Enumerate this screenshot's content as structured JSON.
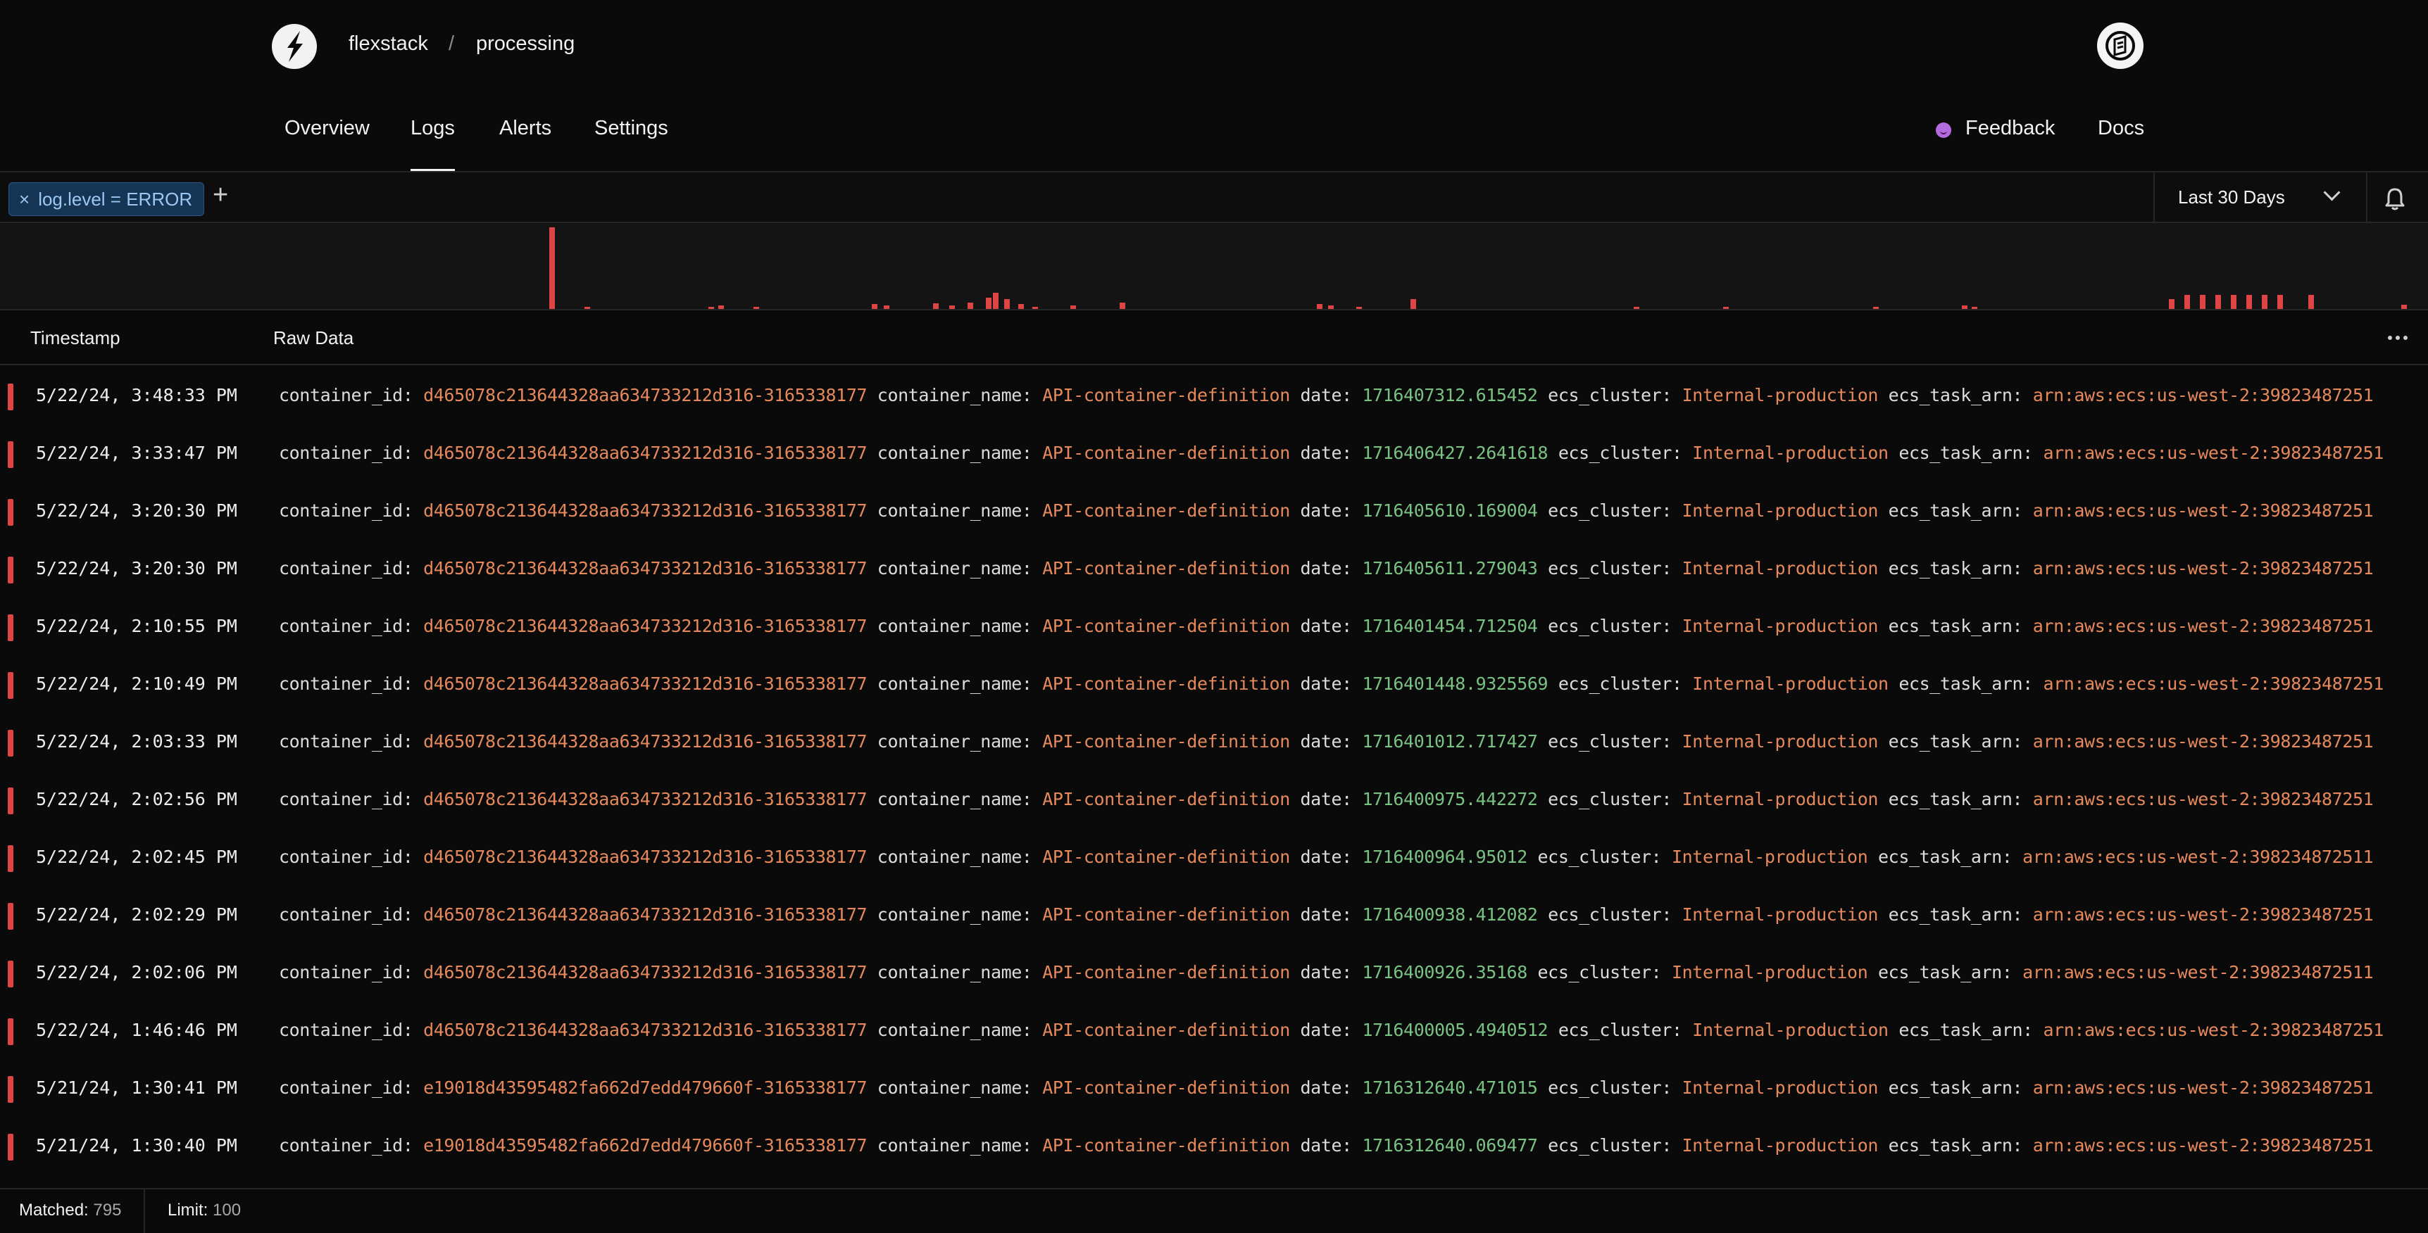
{
  "app": {
    "org": "flexstack",
    "separator": "/",
    "project": "processing"
  },
  "nav": {
    "tabs": [
      {
        "label": "Overview"
      },
      {
        "label": "Logs"
      },
      {
        "label": "Alerts"
      },
      {
        "label": "Settings"
      }
    ],
    "active_tab": "Logs",
    "feedback_label": "Feedback",
    "docs_label": "Docs"
  },
  "filters": {
    "chips": [
      {
        "label": "log.level = ERROR",
        "remove_icon": "close-icon"
      }
    ],
    "add_icon": "plus-icon",
    "time_range": "Last 30 Days",
    "alert_icon": "bell-icon"
  },
  "histogram": {
    "series_color": "#e04545",
    "bars": [
      1.0,
      0.02,
      0.02,
      0.04,
      0.02,
      0.06,
      0.04,
      0.07,
      0.04,
      0.08,
      0.14,
      0.2,
      0.12,
      0.06,
      0.03,
      0.04,
      0.08,
      0.06,
      0.04,
      0.02,
      0.12,
      0.02,
      0.02,
      0.02,
      0.04,
      0.02,
      0.12,
      0.17,
      0.17,
      0.17,
      0.17,
      0.17,
      0.17,
      0.17,
      0.17,
      0.05
    ]
  },
  "table": {
    "columns": [
      "Timestamp",
      "Raw Data"
    ],
    "menu_icon": "more-horizontal-icon",
    "level_color": "#e04545",
    "rows": [
      {
        "ts": "5/22/24, 3:48:33 PM",
        "container_id": "d465078c213644328aa634733212d316-3165338177",
        "container_name": "API-container-definition",
        "date": "1716407312.615452",
        "ecs_cluster": "Internal-production",
        "ecs_task_arn": "arn:aws:ecs:us-west-2:39823487251"
      },
      {
        "ts": "5/22/24, 3:33:47 PM",
        "container_id": "d465078c213644328aa634733212d316-3165338177",
        "container_name": "API-container-definition",
        "date": "1716406427.2641618",
        "ecs_cluster": "Internal-production",
        "ecs_task_arn": "arn:aws:ecs:us-west-2:39823487251"
      },
      {
        "ts": "5/22/24, 3:20:30 PM",
        "container_id": "d465078c213644328aa634733212d316-3165338177",
        "container_name": "API-container-definition",
        "date": "1716405610.169004",
        "ecs_cluster": "Internal-production",
        "ecs_task_arn": "arn:aws:ecs:us-west-2:39823487251"
      },
      {
        "ts": "5/22/24, 3:20:30 PM",
        "container_id": "d465078c213644328aa634733212d316-3165338177",
        "container_name": "API-container-definition",
        "date": "1716405611.279043",
        "ecs_cluster": "Internal-production",
        "ecs_task_arn": "arn:aws:ecs:us-west-2:39823487251"
      },
      {
        "ts": "5/22/24, 2:10:55 PM",
        "container_id": "d465078c213644328aa634733212d316-3165338177",
        "container_name": "API-container-definition",
        "date": "1716401454.712504",
        "ecs_cluster": "Internal-production",
        "ecs_task_arn": "arn:aws:ecs:us-west-2:39823487251"
      },
      {
        "ts": "5/22/24, 2:10:49 PM",
        "container_id": "d465078c213644328aa634733212d316-3165338177",
        "container_name": "API-container-definition",
        "date": "1716401448.9325569",
        "ecs_cluster": "Internal-production",
        "ecs_task_arn": "arn:aws:ecs:us-west-2:39823487251"
      },
      {
        "ts": "5/22/24, 2:03:33 PM",
        "container_id": "d465078c213644328aa634733212d316-3165338177",
        "container_name": "API-container-definition",
        "date": "1716401012.717427",
        "ecs_cluster": "Internal-production",
        "ecs_task_arn": "arn:aws:ecs:us-west-2:39823487251"
      },
      {
        "ts": "5/22/24, 2:02:56 PM",
        "container_id": "d465078c213644328aa634733212d316-3165338177",
        "container_name": "API-container-definition",
        "date": "1716400975.442272",
        "ecs_cluster": "Internal-production",
        "ecs_task_arn": "arn:aws:ecs:us-west-2:39823487251"
      },
      {
        "ts": "5/22/24, 2:02:45 PM",
        "container_id": "d465078c213644328aa634733212d316-3165338177",
        "container_name": "API-container-definition",
        "date": "1716400964.95012",
        "ecs_cluster": "Internal-production",
        "ecs_task_arn": "arn:aws:ecs:us-west-2:398234872511"
      },
      {
        "ts": "5/22/24, 2:02:29 PM",
        "container_id": "d465078c213644328aa634733212d316-3165338177",
        "container_name": "API-container-definition",
        "date": "1716400938.412082",
        "ecs_cluster": "Internal-production",
        "ecs_task_arn": "arn:aws:ecs:us-west-2:39823487251"
      },
      {
        "ts": "5/22/24, 2:02:06 PM",
        "container_id": "d465078c213644328aa634733212d316-3165338177",
        "container_name": "API-container-definition",
        "date": "1716400926.35168",
        "ecs_cluster": "Internal-production",
        "ecs_task_arn": "arn:aws:ecs:us-west-2:398234872511"
      },
      {
        "ts": "5/22/24, 1:46:46 PM",
        "container_id": "d465078c213644328aa634733212d316-3165338177",
        "container_name": "API-container-definition",
        "date": "1716400005.4940512",
        "ecs_cluster": "Internal-production",
        "ecs_task_arn": "arn:aws:ecs:us-west-2:39823487251"
      },
      {
        "ts": "5/21/24, 1:30:41 PM",
        "container_id": "e19018d43595482fa662d7edd479660f-3165338177",
        "container_name": "API-container-definition",
        "date": "1716312640.471015",
        "ecs_cluster": "Internal-production",
        "ecs_task_arn": "arn:aws:ecs:us-west-2:39823487251"
      },
      {
        "ts": "5/21/24, 1:30:40 PM",
        "container_id": "e19018d43595482fa662d7edd479660f-3165338177",
        "container_name": "API-container-definition",
        "date": "1716312640.069477",
        "ecs_cluster": "Internal-production",
        "ecs_task_arn": "arn:aws:ecs:us-west-2:39823487251"
      }
    ]
  },
  "footer": {
    "matched_label": "Matched:",
    "matched_value": "795",
    "limit_label": "Limit:",
    "limit_value": "100"
  },
  "icons": {
    "logo": "flexstack-logo-icon",
    "avatar": "user-avatar-icon",
    "feedback": "feedback-smile-icon"
  }
}
